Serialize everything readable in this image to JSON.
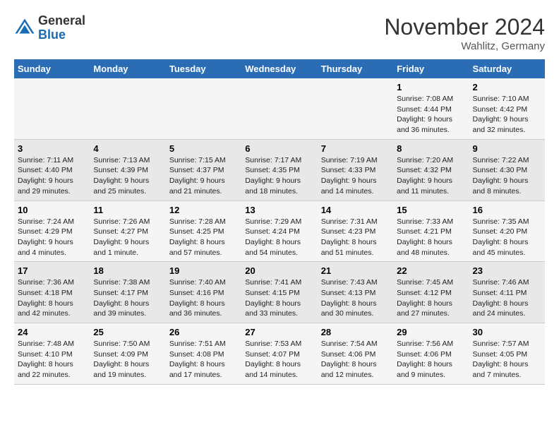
{
  "header": {
    "logo_general": "General",
    "logo_blue": "Blue",
    "month_title": "November 2024",
    "location": "Wahlitz, Germany"
  },
  "columns": [
    "Sunday",
    "Monday",
    "Tuesday",
    "Wednesday",
    "Thursday",
    "Friday",
    "Saturday"
  ],
  "weeks": [
    [
      {
        "day": "",
        "info": ""
      },
      {
        "day": "",
        "info": ""
      },
      {
        "day": "",
        "info": ""
      },
      {
        "day": "",
        "info": ""
      },
      {
        "day": "",
        "info": ""
      },
      {
        "day": "1",
        "info": "Sunrise: 7:08 AM\nSunset: 4:44 PM\nDaylight: 9 hours\nand 36 minutes."
      },
      {
        "day": "2",
        "info": "Sunrise: 7:10 AM\nSunset: 4:42 PM\nDaylight: 9 hours\nand 32 minutes."
      }
    ],
    [
      {
        "day": "3",
        "info": "Sunrise: 7:11 AM\nSunset: 4:40 PM\nDaylight: 9 hours\nand 29 minutes."
      },
      {
        "day": "4",
        "info": "Sunrise: 7:13 AM\nSunset: 4:39 PM\nDaylight: 9 hours\nand 25 minutes."
      },
      {
        "day": "5",
        "info": "Sunrise: 7:15 AM\nSunset: 4:37 PM\nDaylight: 9 hours\nand 21 minutes."
      },
      {
        "day": "6",
        "info": "Sunrise: 7:17 AM\nSunset: 4:35 PM\nDaylight: 9 hours\nand 18 minutes."
      },
      {
        "day": "7",
        "info": "Sunrise: 7:19 AM\nSunset: 4:33 PM\nDaylight: 9 hours\nand 14 minutes."
      },
      {
        "day": "8",
        "info": "Sunrise: 7:20 AM\nSunset: 4:32 PM\nDaylight: 9 hours\nand 11 minutes."
      },
      {
        "day": "9",
        "info": "Sunrise: 7:22 AM\nSunset: 4:30 PM\nDaylight: 9 hours\nand 8 minutes."
      }
    ],
    [
      {
        "day": "10",
        "info": "Sunrise: 7:24 AM\nSunset: 4:29 PM\nDaylight: 9 hours\nand 4 minutes."
      },
      {
        "day": "11",
        "info": "Sunrise: 7:26 AM\nSunset: 4:27 PM\nDaylight: 9 hours\nand 1 minute."
      },
      {
        "day": "12",
        "info": "Sunrise: 7:28 AM\nSunset: 4:25 PM\nDaylight: 8 hours\nand 57 minutes."
      },
      {
        "day": "13",
        "info": "Sunrise: 7:29 AM\nSunset: 4:24 PM\nDaylight: 8 hours\nand 54 minutes."
      },
      {
        "day": "14",
        "info": "Sunrise: 7:31 AM\nSunset: 4:23 PM\nDaylight: 8 hours\nand 51 minutes."
      },
      {
        "day": "15",
        "info": "Sunrise: 7:33 AM\nSunset: 4:21 PM\nDaylight: 8 hours\nand 48 minutes."
      },
      {
        "day": "16",
        "info": "Sunrise: 7:35 AM\nSunset: 4:20 PM\nDaylight: 8 hours\nand 45 minutes."
      }
    ],
    [
      {
        "day": "17",
        "info": "Sunrise: 7:36 AM\nSunset: 4:18 PM\nDaylight: 8 hours\nand 42 minutes."
      },
      {
        "day": "18",
        "info": "Sunrise: 7:38 AM\nSunset: 4:17 PM\nDaylight: 8 hours\nand 39 minutes."
      },
      {
        "day": "19",
        "info": "Sunrise: 7:40 AM\nSunset: 4:16 PM\nDaylight: 8 hours\nand 36 minutes."
      },
      {
        "day": "20",
        "info": "Sunrise: 7:41 AM\nSunset: 4:15 PM\nDaylight: 8 hours\nand 33 minutes."
      },
      {
        "day": "21",
        "info": "Sunrise: 7:43 AM\nSunset: 4:13 PM\nDaylight: 8 hours\nand 30 minutes."
      },
      {
        "day": "22",
        "info": "Sunrise: 7:45 AM\nSunset: 4:12 PM\nDaylight: 8 hours\nand 27 minutes."
      },
      {
        "day": "23",
        "info": "Sunrise: 7:46 AM\nSunset: 4:11 PM\nDaylight: 8 hours\nand 24 minutes."
      }
    ],
    [
      {
        "day": "24",
        "info": "Sunrise: 7:48 AM\nSunset: 4:10 PM\nDaylight: 8 hours\nand 22 minutes."
      },
      {
        "day": "25",
        "info": "Sunrise: 7:50 AM\nSunset: 4:09 PM\nDaylight: 8 hours\nand 19 minutes."
      },
      {
        "day": "26",
        "info": "Sunrise: 7:51 AM\nSunset: 4:08 PM\nDaylight: 8 hours\nand 17 minutes."
      },
      {
        "day": "27",
        "info": "Sunrise: 7:53 AM\nSunset: 4:07 PM\nDaylight: 8 hours\nand 14 minutes."
      },
      {
        "day": "28",
        "info": "Sunrise: 7:54 AM\nSunset: 4:06 PM\nDaylight: 8 hours\nand 12 minutes."
      },
      {
        "day": "29",
        "info": "Sunrise: 7:56 AM\nSunset: 4:06 PM\nDaylight: 8 hours\nand 9 minutes."
      },
      {
        "day": "30",
        "info": "Sunrise: 7:57 AM\nSunset: 4:05 PM\nDaylight: 8 hours\nand 7 minutes."
      }
    ]
  ]
}
